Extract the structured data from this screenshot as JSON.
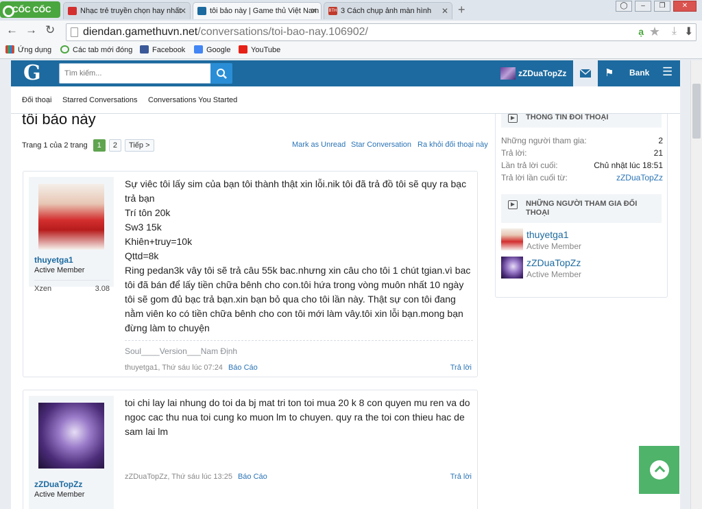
{
  "browser": {
    "logo": "CỐC CỐC",
    "tabs": [
      {
        "title": "Nhạc trẻ truyền chọn hay nhất",
        "favicon_color": "#d32f2f"
      },
      {
        "title": "tôi bảo này | Game thủ Việt Nam",
        "favicon_color": "#1c6a9f"
      },
      {
        "title": "3 Cách chụp ảnh màn hình",
        "favicon_color": "#c0392b",
        "favicon_text": "BTH"
      }
    ],
    "url_host": "diendan.gamethuvn.net",
    "url_path": "/conversations/toi-bao-nay.106902/",
    "bookmarks": [
      {
        "label": "Ứng dụng",
        "icon": "apps-icon"
      },
      {
        "label": "Các tab mới đóng",
        "icon": "recent-tabs-icon"
      },
      {
        "label": "Facebook",
        "icon": "facebook-icon"
      },
      {
        "label": "Google",
        "icon": "google-icon"
      },
      {
        "label": "YouTube",
        "icon": "youtube-icon"
      }
    ]
  },
  "site": {
    "logo": "G",
    "search_placeholder": "Tìm kiếm...",
    "username": "zZDuaTopZz",
    "bank_label": "Bank",
    "accent": "#1c6a9f"
  },
  "subnav": [
    "Đối thoại",
    "Starred Conversations",
    "Conversations You Started"
  ],
  "conversation": {
    "title": "tôi bảo này",
    "page_label": "Trang 1 của 2 trang",
    "current_page": "1",
    "next_page": "2",
    "next_label": "Tiếp >",
    "actions": [
      "Mark as Unread",
      "Star Conversation",
      "Ra khỏi đối thoại này"
    ]
  },
  "messages": [
    {
      "author": "thuyetga1",
      "title": "Active Member",
      "stat_label": "Xzen",
      "stat_value": "3.08",
      "lines": [
        "Sự viêc tôi lấy sim của bạn tôi thành thật xin lỗi.nik tôi đã trả đồ tôi sẽ quy ra bạc trả bạn",
        "Trí tôn 20k",
        "Sw3 15k",
        "Khiên+truy=10k",
        "Qttd=8k",
        "Ring pedan3k vây tôi sẽ trả câu 55k bac.nhưng xin câu cho tôi 1 chút tgian.vì bac tôi đã bán để lấy tiền chữa bênh cho con.tôi hứa trong vòng muôn nhất 10 ngày tôi sẽ gom đủ bạc trả bạn.xin bạn bỏ qua cho tôi lần này. Thật sự con tôi đang nằm viên ko có tiền chữa bênh cho con tôi mới làm vây.tôi xin lỗi bạn.mong bạn đừng làm to chuyện"
      ],
      "signature": "Soul____Version___Nam Định",
      "meta": "thuyetga1, Thứ sáu lúc 07:24",
      "report": "Báo Cáo",
      "reply": "Trả lời"
    },
    {
      "author": "zZDuaTopZz",
      "title": "Active Member",
      "lines": [
        "toi chi lay lai nhung do toi da bj mat tri ton toi mua 20 k 8 con quyen mu ren va do ngoc cac thu nua toi cung ko muon lm to chuyen. quy ra the toi con thieu hac de sam lai lm"
      ],
      "meta": "zZDuaTopZz, Thứ sáu lúc 13:25",
      "report": "Báo Cáo",
      "reply": "Trả lời"
    }
  ],
  "sidebar": {
    "info_title": "THÔNG TIN ĐỐI THOẠI",
    "rows": [
      {
        "label": "Những người tham gia:",
        "value": "2"
      },
      {
        "label": "Trả lời:",
        "value": "21"
      },
      {
        "label": "Lần trả lời cuối:",
        "value": "Chủ nhật lúc 18:51"
      },
      {
        "label": "Trả lời lần cuối từ:",
        "value": "zZDuaTopZz"
      }
    ],
    "participants_title": "NHỮNG NGƯỜI THAM GIA ĐỐI THOẠI",
    "participants": [
      {
        "name": "thuyetga1",
        "title": "Active Member"
      },
      {
        "name": "zZDuaTopZz",
        "title": "Active Member"
      }
    ]
  }
}
